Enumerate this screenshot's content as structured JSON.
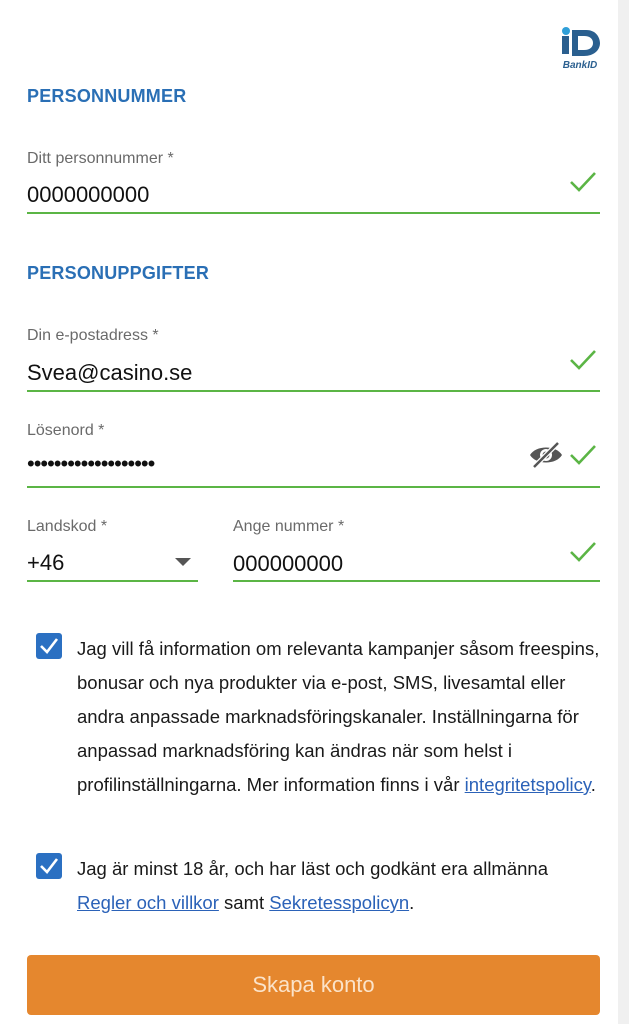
{
  "brand": {
    "logo_text": "BankID"
  },
  "sections": {
    "personnummer_title": "PERSONNUMMER",
    "personuppgifter_title": "PERSONUPPGIFTER"
  },
  "fields": {
    "personnummer": {
      "label": "Ditt personnummer *",
      "value": "0000000000"
    },
    "email": {
      "label": "Din e-postadress *",
      "value": "Svea@casino.se"
    },
    "password": {
      "label": "Lösenord *",
      "value": "•••••••••••••••••••"
    },
    "country_code": {
      "label": "Landskod *",
      "value": "+46"
    },
    "phone": {
      "label": "Ange nummer *",
      "value": "000000000"
    }
  },
  "consents": {
    "marketing": {
      "checked": true,
      "text": "Jag vill få information om relevanta kampanjer såsom freespins, bonusar och nya produkter via e-post, SMS, livesamtal eller andra anpassade marknadsföringskanaler. Inställningarna för anpassad marknadsföring kan ändras när som helst i profilinställningarna. Mer information finns i vår ",
      "link": "integritetspolicy",
      "suffix": "."
    },
    "terms": {
      "checked": true,
      "text": "Jag är minst 18 år, och har läst och godkänt era allmänna ",
      "link1": "Regler och villkor",
      "middle": " samt ",
      "link2": "Sekretesspolicyn",
      "suffix": "."
    }
  },
  "actions": {
    "submit_label": "Skapa konto"
  },
  "colors": {
    "section_title": "#2a6fb5",
    "valid": "#5bb545",
    "checkbox": "#2b70c2",
    "link": "#2b62b8",
    "button": "#e5872e"
  },
  "icons": {
    "logo": "bankid-logo-icon",
    "valid": "checkmark-icon",
    "password_toggle": "eye-off-icon",
    "dropdown": "caret-down-icon",
    "checkbox": "checkbox-checked-icon"
  }
}
